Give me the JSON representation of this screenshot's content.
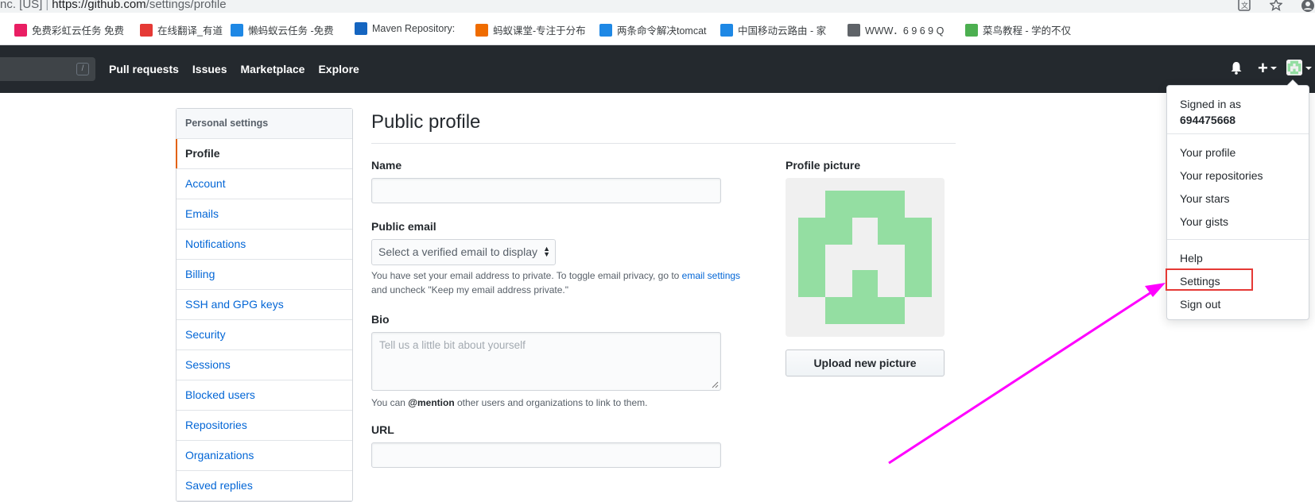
{
  "browser": {
    "security_label": "nc. [US]",
    "url_host": "https://github.com",
    "url_path": "/settings/profile",
    "icons": [
      "translate-icon",
      "star-icon",
      "account-icon"
    ]
  },
  "bookmarks": [
    {
      "label": "免费彩虹云任务 免费",
      "icon": "rainbow-icon",
      "color": "#e91e63"
    },
    {
      "label": "在线翻译_有道",
      "icon": "youdao-icon",
      "color": "#e53935"
    },
    {
      "label": "懒蚂蚁云任务 -免费",
      "icon": "shield-icon",
      "color": "#1e88e5"
    },
    {
      "label": "Maven Repository:",
      "icon": "maven-icon",
      "color": "#1565c0"
    },
    {
      "label": "蚂蚁课堂-专注于分布",
      "icon": "m-logo-icon",
      "color": "#ef6c00"
    },
    {
      "label": "两条命令解决tomcat",
      "icon": "paw-icon",
      "color": "#1e88e5"
    },
    {
      "label": "中国移动云路由 - 家",
      "icon": "signal-icon",
      "color": "#1e88e5"
    },
    {
      "label": "WWW．6 9 6 9 Q",
      "icon": "page-icon",
      "color": "#5f6368"
    },
    {
      "label": "菜鸟教程 - 学的不仅",
      "icon": "runoob-icon",
      "color": "#4caf50"
    }
  ],
  "header": {
    "search_hint": "/",
    "nav": [
      "Pull requests",
      "Issues",
      "Marketplace",
      "Explore"
    ]
  },
  "sidebar": {
    "heading": "Personal settings",
    "items": [
      {
        "label": "Profile",
        "active": true
      },
      {
        "label": "Account"
      },
      {
        "label": "Emails"
      },
      {
        "label": "Notifications"
      },
      {
        "label": "Billing"
      },
      {
        "label": "SSH and GPG keys"
      },
      {
        "label": "Security"
      },
      {
        "label": "Sessions"
      },
      {
        "label": "Blocked users"
      },
      {
        "label": "Repositories"
      },
      {
        "label": "Organizations"
      },
      {
        "label": "Saved replies"
      }
    ]
  },
  "main": {
    "title": "Public profile",
    "name_label": "Name",
    "name_value": "",
    "email_label": "Public email",
    "email_select": "Select a verified email to display",
    "email_note_1": "You have set your email address to private. To toggle email privacy, go to",
    "email_note_link": "email settings",
    "email_note_2": "and uncheck \"Keep my email address private.\"",
    "bio_label": "Bio",
    "bio_placeholder": "Tell us a little bit about yourself",
    "bio_note_1": "You can",
    "bio_note_mention": "@mention",
    "bio_note_2": "other users and organizations to link to them.",
    "url_label": "URL",
    "url_value": "",
    "picture_label": "Profile picture",
    "upload_button": "Upload new picture"
  },
  "dropdown": {
    "signed_in_as": "Signed in as",
    "username": "694475668",
    "group1": [
      "Your profile",
      "Your repositories",
      "Your stars",
      "Your gists"
    ],
    "group2": [
      "Help",
      "Settings",
      "Sign out"
    ],
    "highlighted": "Settings"
  },
  "colors": {
    "header_bg": "#24292e",
    "link": "#0366d6",
    "active_marker": "#e36209",
    "identicon": "#94dea2",
    "annotation_arrow": "#ff00ff",
    "annotation_box": "#e53935"
  }
}
